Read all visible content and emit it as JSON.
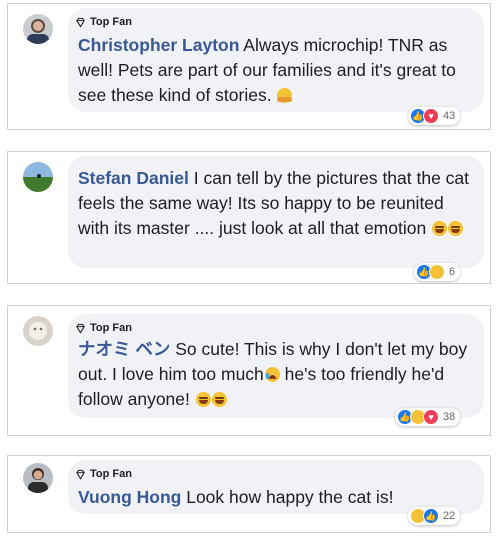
{
  "comments": [
    {
      "badge": "Top Fan",
      "author": "Christopher Layton",
      "text": " Always microchip! TNR as well! Pets are part of our families and it's great to see these kind of stories.",
      "reaction_count": "43",
      "reactions": [
        "like-icon",
        "love-icon"
      ]
    },
    {
      "author": "Stefan Daniel",
      "text": " I can tell by the pictures that the cat feels the same way! Its so happy to be reunited with its master .... just look at all that emotion",
      "reaction_count": "6",
      "reactions": [
        "like-icon",
        "haha-icon"
      ]
    },
    {
      "badge": "Top Fan",
      "author": "ナオミ ベン",
      "text_a": " So cute! This is why I don't let my boy out. I love him too much",
      "text_b": " he's too friendly he'd follow anyone!",
      "reaction_count": "38",
      "reactions": [
        "like-icon",
        "haha-icon",
        "love-icon"
      ]
    },
    {
      "badge": "Top Fan",
      "author": "Vuong Hong",
      "text": " Look how happy the cat is!",
      "reaction_count": "22",
      "reactions": [
        "haha-icon",
        "like-icon"
      ]
    }
  ]
}
